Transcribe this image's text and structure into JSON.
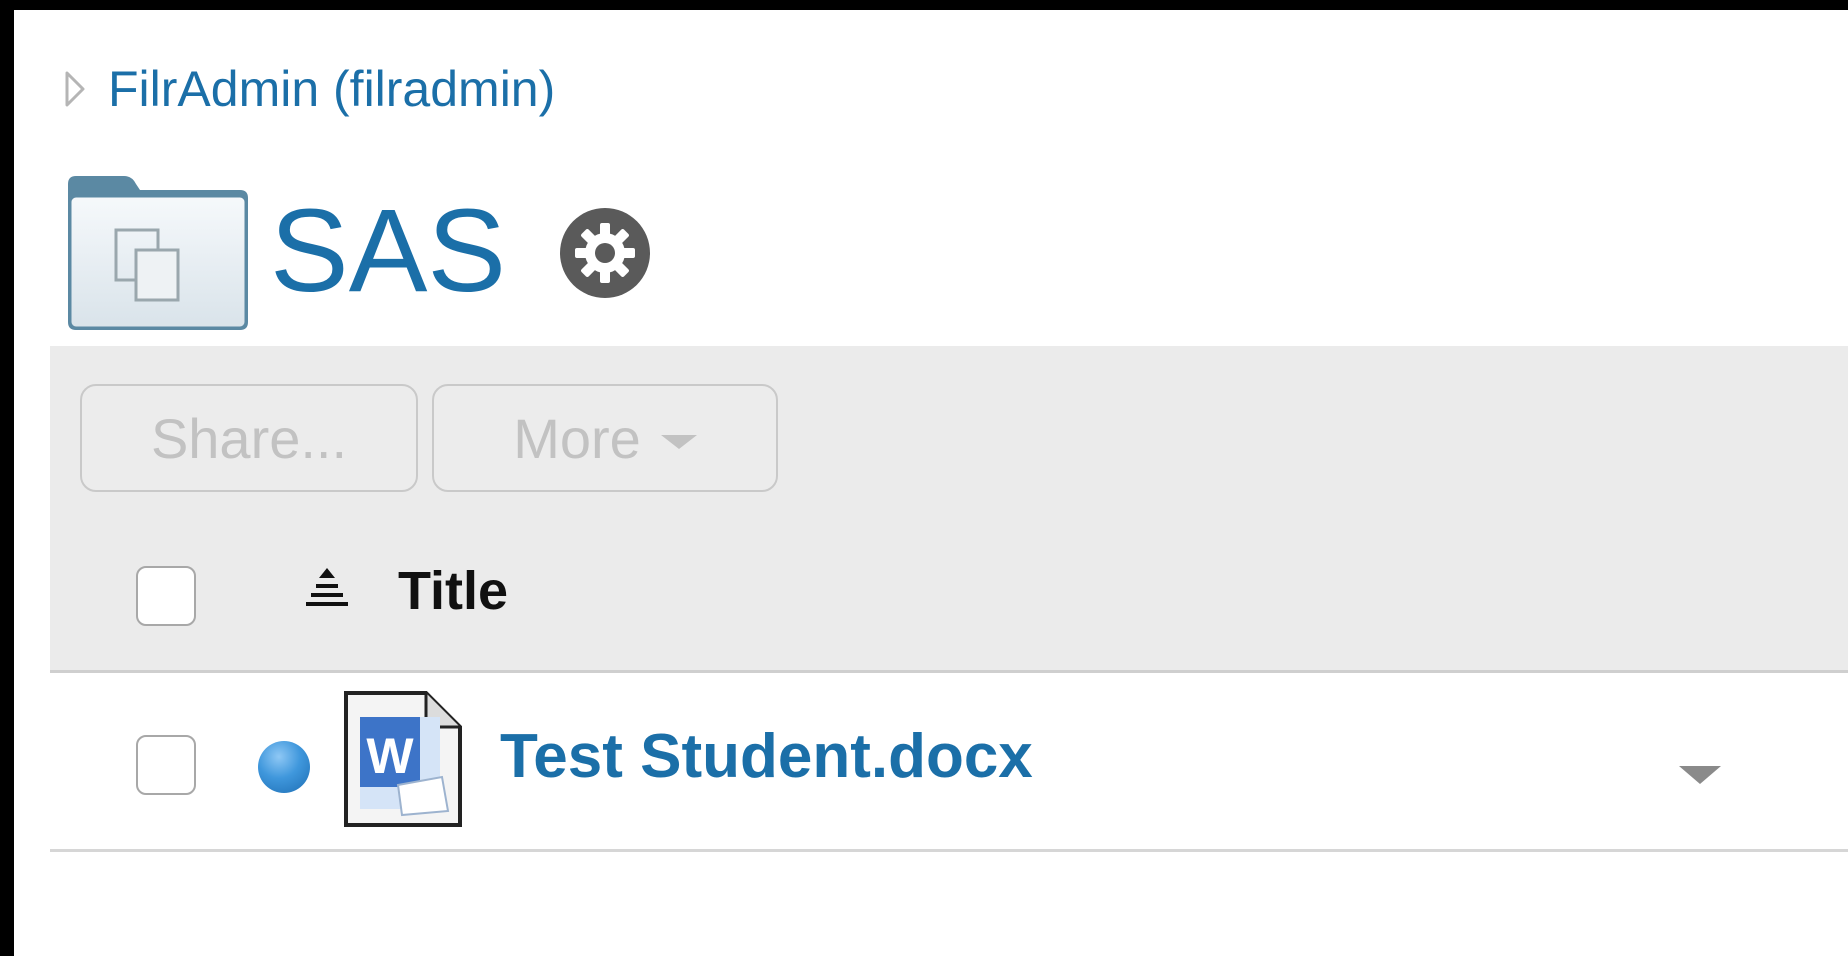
{
  "breadcrumb": {
    "user_label": "FilrAdmin (filradmin)"
  },
  "header": {
    "title": "SAS"
  },
  "toolbar": {
    "share_label": "Share...",
    "more_label": "More"
  },
  "table": {
    "columns": [
      "Title"
    ],
    "rows": [
      {
        "name": "Test Student.docx",
        "type_icon": "word-document-icon",
        "status": "unread-dot"
      }
    ]
  },
  "colors": {
    "link": "#1b6fa8",
    "panel_bg": "#ebebeb",
    "disabled_text": "#c2c2c2"
  }
}
